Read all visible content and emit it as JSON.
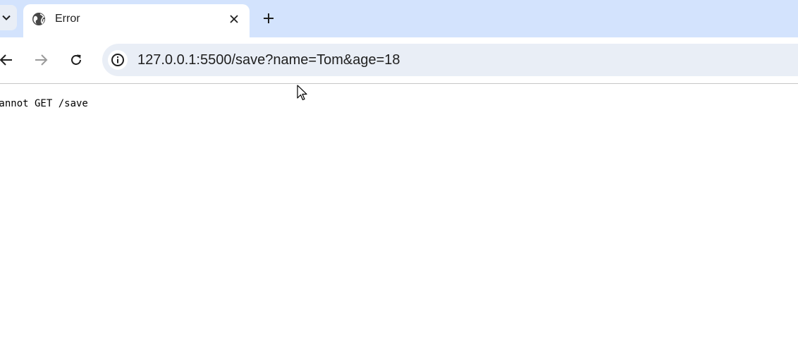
{
  "browser": {
    "tab": {
      "title": "Error",
      "favicon": "globe-icon",
      "close_icon": "close-icon"
    },
    "tab_search_icon": "chevron-down-icon",
    "new_tab_icon": "plus-icon",
    "toolbar": {
      "back_icon": "arrow-left-icon",
      "forward_icon": "arrow-right-icon",
      "reload_icon": "reload-icon",
      "site_info_icon": "info-icon",
      "url": "127.0.0.1:5500/save?name=Tom&age=18"
    },
    "colors": {
      "tabstrip": "#d3e3fd",
      "omnibox": "#e9eef6",
      "active_tab": "#ffffff"
    }
  },
  "page": {
    "error_message": "Cannot GET /save"
  }
}
